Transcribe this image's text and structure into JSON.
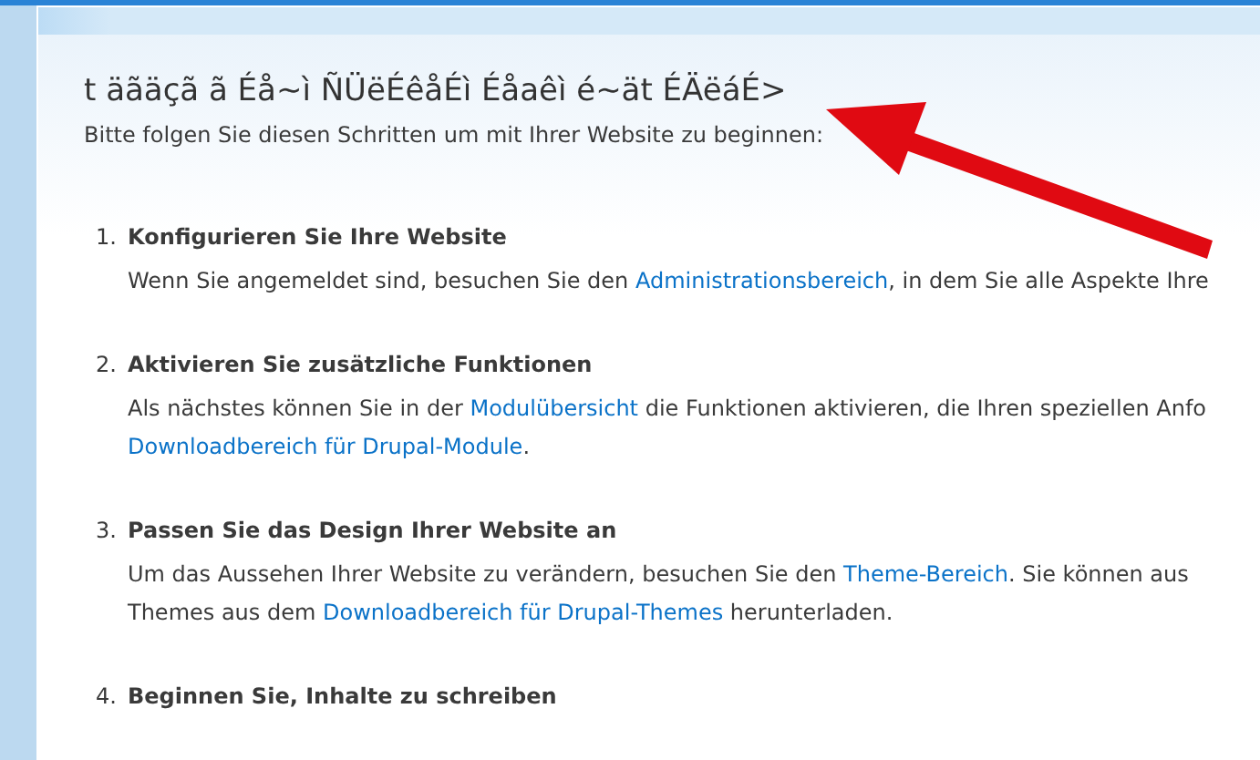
{
  "page": {
    "title": "t äãäçã ã Éå~ì ÑÜëÉêåÉì Éåaêì é~ät ÉÄëáÉ>",
    "intro": "Bitte folgen Sie diesen Schritten um mit Ihrer Website zu beginnen:"
  },
  "steps": [
    {
      "number": "1.",
      "heading": "Konfigurieren Sie Ihre Website",
      "lines": [
        [
          {
            "text": "Wenn Sie angemeldet sind, besuchen Sie den ",
            "link": false
          },
          {
            "text": "Administrationsbereich",
            "link": true
          },
          {
            "text": ", in dem Sie alle Aspekte Ihre",
            "link": false
          }
        ]
      ]
    },
    {
      "number": "2.",
      "heading": "Aktivieren Sie zusätzliche Funktionen",
      "lines": [
        [
          {
            "text": "Als nächstes können Sie in der ",
            "link": false
          },
          {
            "text": "Modulübersicht",
            "link": true
          },
          {
            "text": " die Funktionen aktivieren, die Ihren speziellen Anfo",
            "link": false
          }
        ],
        [
          {
            "text": "Downloadbereich für Drupal-Module",
            "link": true
          },
          {
            "text": ".",
            "link": false
          }
        ]
      ]
    },
    {
      "number": "3.",
      "heading": "Passen Sie das Design Ihrer Website an",
      "lines": [
        [
          {
            "text": "Um das Aussehen Ihrer Website zu verändern, besuchen Sie den ",
            "link": false
          },
          {
            "text": "Theme-Bereich",
            "link": true
          },
          {
            "text": ". Sie können aus",
            "link": false
          }
        ],
        [
          {
            "text": "Themes aus dem ",
            "link": false
          },
          {
            "text": "Downloadbereich für Drupal-Themes",
            "link": true
          },
          {
            "text": " herunterladen.",
            "link": false
          }
        ]
      ]
    },
    {
      "number": "4.",
      "heading": "Beginnen Sie, Inhalte zu schreiben"
    }
  ]
}
